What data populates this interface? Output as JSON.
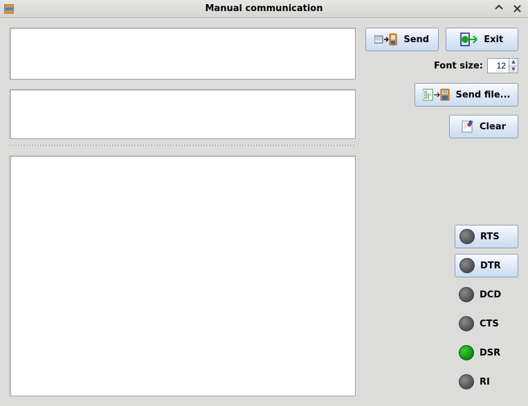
{
  "window": {
    "title": "Manual communication"
  },
  "buttons": {
    "send": "Send",
    "exit": "Exit",
    "send_file": "Send file...",
    "clear": "Clear"
  },
  "font": {
    "label": "Font size:",
    "value": "12"
  },
  "fields": {
    "input": "",
    "echo": "",
    "log": ""
  },
  "signals": [
    {
      "name": "RTS",
      "toggle": true,
      "on": false
    },
    {
      "name": "DTR",
      "toggle": true,
      "on": false
    },
    {
      "name": "DCD",
      "toggle": false,
      "on": false
    },
    {
      "name": "CTS",
      "toggle": false,
      "on": false
    },
    {
      "name": "DSR",
      "toggle": false,
      "on": true
    },
    {
      "name": "RI",
      "toggle": false,
      "on": false
    }
  ]
}
